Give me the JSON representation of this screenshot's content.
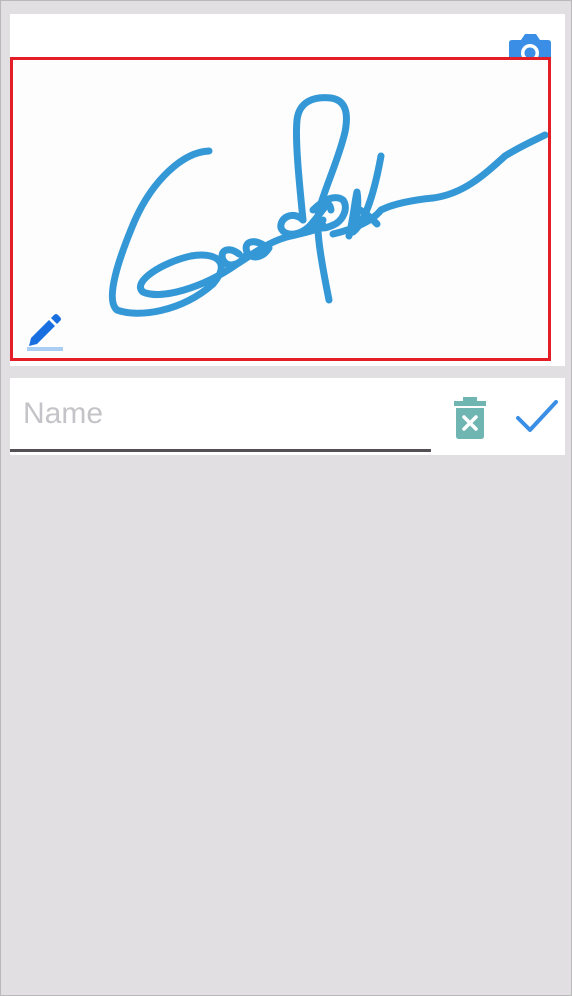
{
  "name_field": {
    "placeholder": "Name",
    "value": ""
  },
  "icons": {
    "camera": "camera-icon",
    "pen": "pen-icon",
    "trash": "trash-icon",
    "confirm": "checkmark-icon"
  },
  "colors": {
    "background": "#e2dfe2",
    "card": "#ffffff",
    "signature_ink": "#3498d6",
    "selection_border": "#e31e26",
    "camera_icon": "#3a8ee6",
    "pen_icon": "#1a6fe0",
    "trash_icon": "#6fb6b2",
    "check_icon": "#3a8ee6",
    "input_underline": "#555055",
    "placeholder": "#c4c4c8"
  }
}
